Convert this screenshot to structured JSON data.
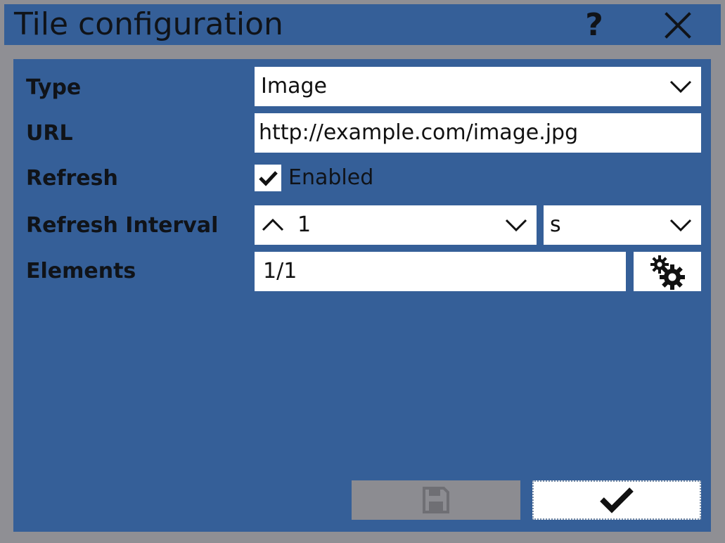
{
  "dialog": {
    "title": "Tile configuration",
    "help_icon": "question-mark-icon",
    "close_icon": "close-icon"
  },
  "form": {
    "type": {
      "label": "Type",
      "value": "Image",
      "icon": "chevron-down-icon"
    },
    "url": {
      "label": "URL",
      "value": "http://example.com/image.jpg"
    },
    "refresh": {
      "label": "Refresh",
      "checked": true,
      "checkbox_label": "Enabled",
      "icon": "checkmark-icon"
    },
    "refresh_interval": {
      "label": "Refresh Interval",
      "value": "1",
      "unit": "s",
      "up_icon": "chevron-up-icon",
      "down_icon": "chevron-down-icon"
    },
    "elements": {
      "label": "Elements",
      "value": "1/1",
      "settings_icon": "gears-icon"
    }
  },
  "footer": {
    "save_icon": "floppy-disk-icon",
    "save_enabled": false,
    "ok_icon": "checkmark-icon"
  },
  "colors": {
    "frame": "#8f8f94",
    "panel": "#355f98",
    "field": "#ffffff",
    "disabled_button": "#8c8c91",
    "text": "#101318"
  }
}
